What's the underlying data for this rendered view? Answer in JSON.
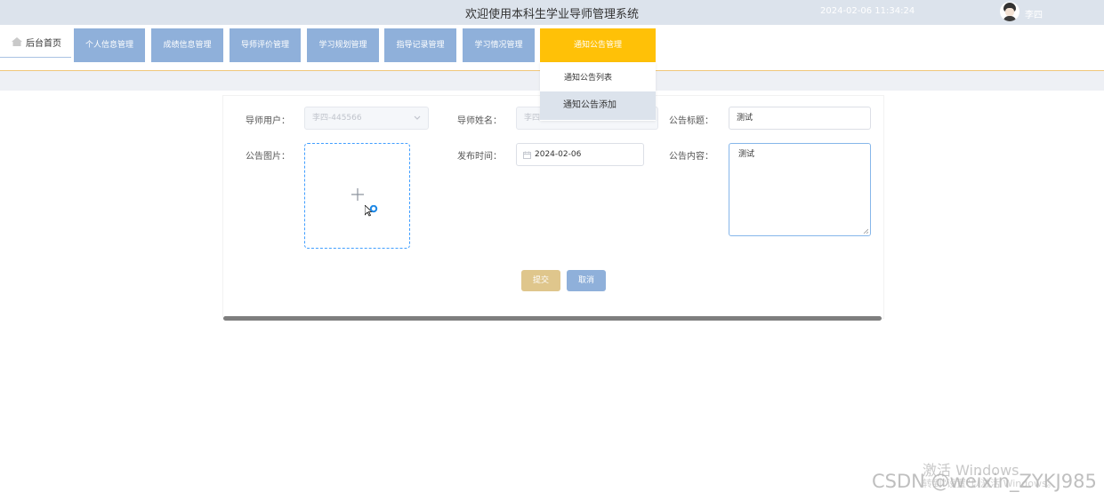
{
  "header": {
    "title": "欢迎使用本科生学业导师管理系统",
    "datetime": "2024-02-06 11:34:24",
    "username": "李四"
  },
  "nav": {
    "home": "后台首页",
    "tabs": [
      "个人信息管理",
      "成绩信息管理",
      "导师评价管理",
      "学习规划管理",
      "指导记录管理",
      "学习情况管理",
      "通知公告管理"
    ],
    "active_index": 6
  },
  "dropdown": {
    "items": [
      "通知公告列表",
      "通知公告添加"
    ],
    "highlighted_index": 1
  },
  "form": {
    "tutor_user_label": "导师用户：",
    "tutor_user_value": "李四-445566",
    "tutor_name_label": "导师姓名：",
    "tutor_name_value": "李四",
    "title_label": "公告标题：",
    "title_value": "测试",
    "image_label": "公告图片：",
    "date_label": "发布时间：",
    "date_value": "2024-02-06",
    "content_label": "公告内容：",
    "content_value": "测试",
    "submit_label": "提交",
    "cancel_label": "取消"
  },
  "watermark": {
    "activate": "激活 Windows",
    "activate_sub": "转到\"设置\"以激活 Windows。",
    "csdn": "CSDN @weixin_ZYKJ985"
  },
  "colors": {
    "nav_tab": "#8fb0da",
    "nav_active": "#ffc107",
    "submit": "#dfc68c",
    "cancel": "#8fb0da",
    "focus_border": "#409eff"
  }
}
